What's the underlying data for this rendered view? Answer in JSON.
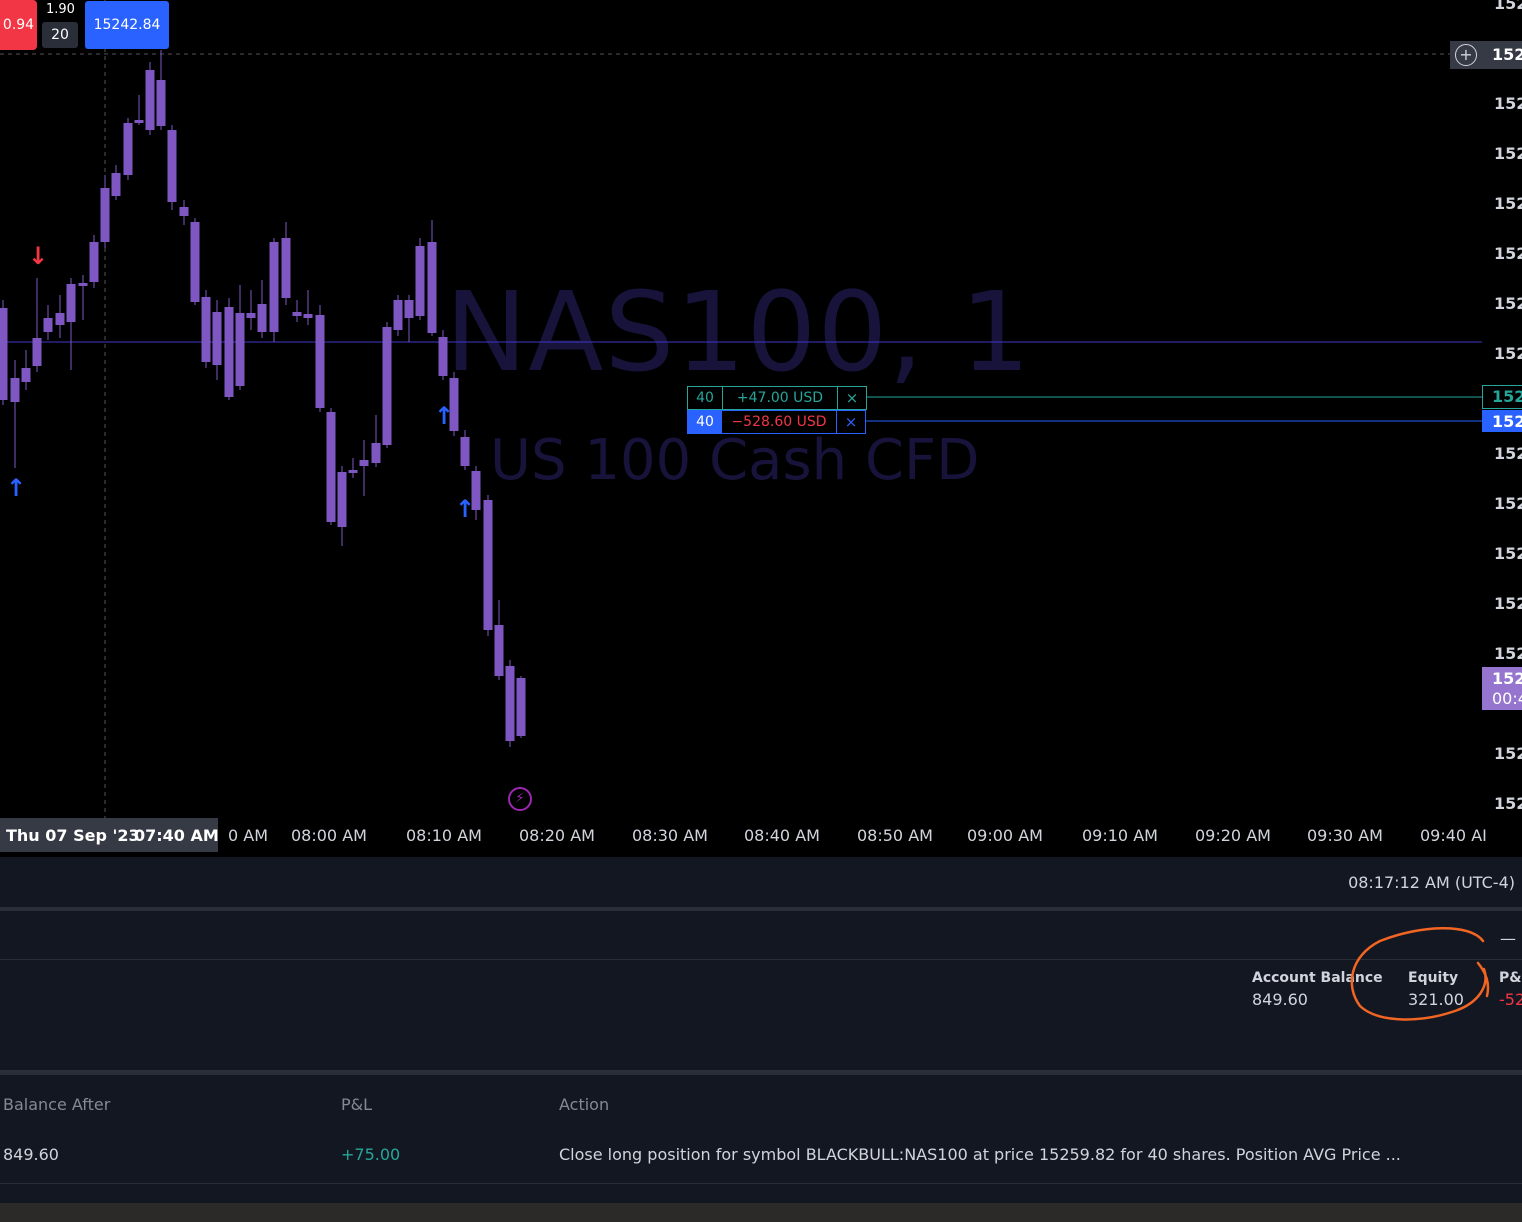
{
  "colors": {
    "candle": "#7e57c2",
    "up_arrow": "#2962ff",
    "down_arrow": "#f23645",
    "positive": "#26a69a",
    "negative": "#f23645",
    "annotation_circle": "#f26522"
  },
  "header": {
    "sell_price_partial": "0.94",
    "spread": "1.90",
    "quantity": "20",
    "buy_price": "15242.84"
  },
  "watermark": {
    "symbol": "NAS100, 1",
    "description": "US 100 Cash CFD"
  },
  "price_axis": {
    "labels": [
      "152",
      "152",
      "152",
      "152",
      "152",
      "152",
      "152",
      "152",
      "152",
      "152",
      "152",
      "152",
      "152",
      "152",
      "152",
      "152",
      "152"
    ],
    "crosshair_label": "152",
    "order_label": "152",
    "tp_label": "152",
    "current_price_label": "152",
    "current_countdown_label": "00:4"
  },
  "orders": [
    {
      "qty": "40",
      "pl": "+47.00 USD",
      "close": "×"
    },
    {
      "qty": "40",
      "pl": "−528.60 USD",
      "close": "×"
    }
  ],
  "time_axis": {
    "crosshair_date": "Thu 07 Sep '23",
    "crosshair_time": "07:40 AM",
    "partial_label": "0 AM",
    "labels": [
      "08:00 AM",
      "08:10 AM",
      "08:20 AM",
      "08:30 AM",
      "08:40 AM",
      "08:50 AM",
      "09:00 AM",
      "09:10 AM",
      "09:20 AM",
      "09:30 AM",
      "09:40 AI"
    ]
  },
  "bottom_bar": {
    "clock": "08:17:12 AM (UTC-4)"
  },
  "account": {
    "minimize_label": "—",
    "balance_label": "Account Balance",
    "balance_value": "849.60",
    "equity_label": "Equity",
    "equity_value": "321.00",
    "pl_label": "P&L",
    "pl_value": "-52"
  },
  "history_table": {
    "columns": [
      "Balance After",
      "P&L",
      "Action"
    ],
    "rows": [
      {
        "balance_after": "849.60",
        "pl": "+75.00",
        "action": "Close long position for symbol BLACKBULL:NAS100 at price 15259.82 for 40 shares. Position AVG Price ..."
      }
    ]
  },
  "signals": {
    "down_arrow": "↓",
    "up_arrow": "↑"
  }
}
